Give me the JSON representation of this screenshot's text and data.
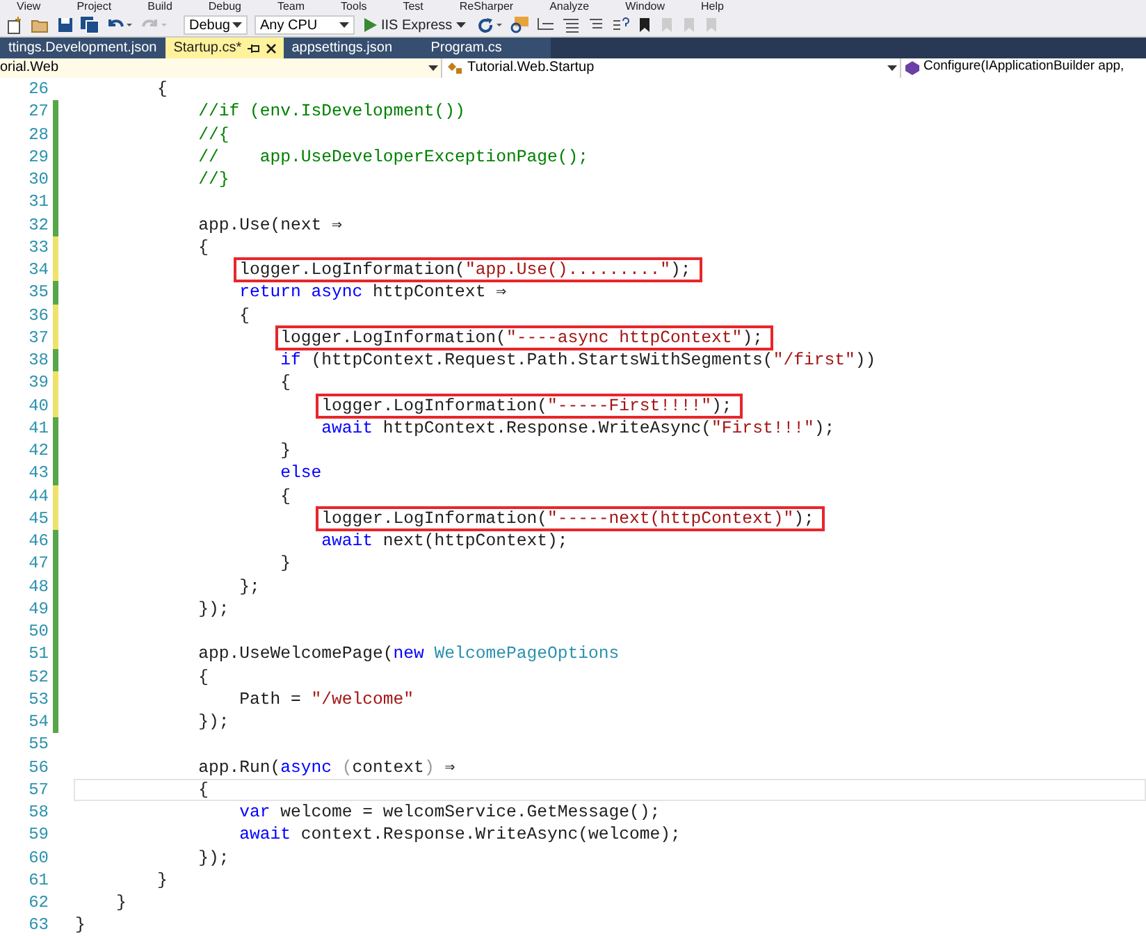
{
  "menu_bar": [
    "View",
    "Project",
    "Build",
    "Debug",
    "Team",
    "Tools",
    "Test",
    "ReSharper",
    "Analyze",
    "Window",
    "Help"
  ],
  "toolbar": {
    "configuration": "Debug",
    "platform": "Any CPU",
    "run_target": "IIS Express"
  },
  "tabs": [
    {
      "label": "ttings.Development.json",
      "selected": false
    },
    {
      "label": "Startup.cs*",
      "selected": true
    },
    {
      "label": "appsettings.json",
      "selected": false
    },
    {
      "label": "Program.cs",
      "selected": false
    }
  ],
  "navigation_bar": {
    "project": "orial.Web",
    "type": "Tutorial.Web.Startup",
    "member": "Configure(IApplicationBuilder app,"
  },
  "code_lines": [
    {
      "number": "26",
      "boxed": false,
      "current": false,
      "segments": [
        {
          "text": "        {",
          "kind": "plain"
        }
      ]
    },
    {
      "number": "27",
      "color": "#57a64a",
      "boxed": false,
      "current": false,
      "segments": [
        {
          "text": "            //if (env.IsDevelopment())",
          "kind": "comment"
        }
      ]
    },
    {
      "number": "28",
      "color": "#57a64a",
      "boxed": false,
      "current": false,
      "segments": [
        {
          "text": "            //{",
          "kind": "comment"
        }
      ]
    },
    {
      "number": "29",
      "color": "#57a64a",
      "boxed": false,
      "current": false,
      "segments": [
        {
          "text": "            //    app.UseDeveloperExceptionPage();",
          "kind": "comment"
        }
      ]
    },
    {
      "number": "30",
      "color": "#57a64a",
      "boxed": false,
      "current": false,
      "segments": [
        {
          "text": "            //}",
          "kind": "comment"
        }
      ]
    },
    {
      "number": "31",
      "color": "#57a64a",
      "current": false
    },
    {
      "number": "32",
      "color": "#57a64a",
      "boxed": false,
      "current": false,
      "segments": [
        {
          "text": "            app.Use(next ⇒",
          "kind": "plain"
        }
      ]
    },
    {
      "number": "33",
      "color": "#efe26b",
      "boxed": false,
      "current": false,
      "segments": [
        {
          "text": "            {",
          "kind": "plain"
        }
      ]
    },
    {
      "number": "34",
      "color": "#efe26b",
      "boxed": true,
      "current": false,
      "segments": [
        {
          "text": "                logger.LogInformation(",
          "kind": "plain"
        },
        {
          "text": "\"app.Use().........\"",
          "kind": "string"
        },
        {
          "text": ");",
          "kind": "plain"
        }
      ]
    },
    {
      "number": "35",
      "color": "#57a64a",
      "boxed": false,
      "current": false,
      "segments": [
        {
          "text": "                return async",
          "kind": "keyword"
        },
        {
          "text": " httpContext ⇒",
          "kind": "plain"
        }
      ]
    },
    {
      "number": "36",
      "color": "#efe26b",
      "boxed": false,
      "current": false,
      "segments": [
        {
          "text": "                {",
          "kind": "plain"
        }
      ]
    },
    {
      "number": "37",
      "color": "#efe26b",
      "boxed": true,
      "current": false,
      "segments": [
        {
          "text": "                    logger.LogInformation(",
          "kind": "plain"
        },
        {
          "text": "\"----async httpContext\"",
          "kind": "string"
        },
        {
          "text": ");",
          "kind": "plain"
        }
      ]
    },
    {
      "number": "38",
      "color": "#57a64a",
      "boxed": false,
      "current": false,
      "segments": [
        {
          "text": "                    if",
          "kind": "keyword"
        },
        {
          "text": " (httpContext.Request.Path.StartsWithSegments(",
          "kind": "plain"
        },
        {
          "text": "\"/first\"",
          "kind": "string"
        },
        {
          "text": "))",
          "kind": "plain"
        }
      ]
    },
    {
      "number": "39",
      "color": "#efe26b",
      "boxed": false,
      "current": false,
      "segments": [
        {
          "text": "                    {",
          "kind": "plain"
        }
      ]
    },
    {
      "number": "40",
      "color": "#efe26b",
      "boxed": true,
      "current": false,
      "segments": [
        {
          "text": "                        logger.LogInformation(",
          "kind": "plain"
        },
        {
          "text": "\"-----First!!!!\"",
          "kind": "string"
        },
        {
          "text": ");",
          "kind": "plain"
        }
      ]
    },
    {
      "number": "41",
      "color": "#57a64a",
      "boxed": false,
      "current": false,
      "segments": [
        {
          "text": "                        await",
          "kind": "keyword"
        },
        {
          "text": " httpContext.Response.WriteAsync(",
          "kind": "plain"
        },
        {
          "text": "\"First!!!\"",
          "kind": "string"
        },
        {
          "text": ");",
          "kind": "plain"
        }
      ]
    },
    {
      "number": "42",
      "color": "#57a64a",
      "boxed": false,
      "current": false,
      "segments": [
        {
          "text": "                    }",
          "kind": "plain"
        }
      ]
    },
    {
      "number": "43",
      "color": "#57a64a",
      "boxed": false,
      "current": false,
      "segments": [
        {
          "text": "                    else",
          "kind": "keyword"
        }
      ]
    },
    {
      "number": "44",
      "color": "#efe26b",
      "boxed": false,
      "current": false,
      "segments": [
        {
          "text": "                    {",
          "kind": "plain"
        }
      ]
    },
    {
      "number": "45",
      "color": "#efe26b",
      "boxed": true,
      "current": false,
      "segments": [
        {
          "text": "                        logger.LogInformation(",
          "kind": "plain"
        },
        {
          "text": "\"-----next(httpContext)\"",
          "kind": "string"
        },
        {
          "text": ");",
          "kind": "plain"
        }
      ]
    },
    {
      "number": "46",
      "color": "#57a64a",
      "boxed": false,
      "current": false,
      "segments": [
        {
          "text": "                        await",
          "kind": "keyword"
        },
        {
          "text": " next(httpContext);",
          "kind": "plain"
        }
      ]
    },
    {
      "number": "47",
      "color": "#57a64a",
      "boxed": false,
      "current": false,
      "segments": [
        {
          "text": "                    }",
          "kind": "plain"
        }
      ]
    },
    {
      "number": "48",
      "color": "#57a64a",
      "boxed": false,
      "current": false,
      "segments": [
        {
          "text": "                };",
          "kind": "plain"
        }
      ]
    },
    {
      "number": "49",
      "color": "#57a64a",
      "boxed": false,
      "current": false,
      "segments": [
        {
          "text": "            });",
          "kind": "plain"
        }
      ]
    },
    {
      "number": "50",
      "color": "#57a64a",
      "current": false
    },
    {
      "number": "51",
      "color": "#57a64a",
      "boxed": false,
      "current": false,
      "segments": [
        {
          "text": "            app.UseWelcomePage(",
          "kind": "plain"
        },
        {
          "text": "new",
          "kind": "keyword"
        },
        {
          "text": " WelcomePageOptions",
          "kind": "type"
        }
      ]
    },
    {
      "number": "52",
      "color": "#57a64a",
      "boxed": false,
      "current": false,
      "segments": [
        {
          "text": "            {",
          "kind": "plain"
        }
      ]
    },
    {
      "number": "53",
      "color": "#57a64a",
      "boxed": false,
      "current": false,
      "segments": [
        {
          "text": "                Path = ",
          "kind": "plain"
        },
        {
          "text": "\"/welcome\"",
          "kind": "string"
        }
      ]
    },
    {
      "number": "54",
      "color": "#57a64a",
      "boxed": false,
      "current": false,
      "segments": [
        {
          "text": "            });",
          "kind": "plain"
        }
      ]
    },
    {
      "number": "55",
      "current": false
    },
    {
      "number": "56",
      "boxed": false,
      "current": false,
      "segments": [
        {
          "text": "            app.Run(",
          "kind": "plain"
        },
        {
          "text": "async",
          "kind": "keyword"
        },
        {
          "text": " (",
          "kind": "dim"
        },
        {
          "text": "context",
          "kind": "plain"
        },
        {
          "text": ")",
          "kind": "dim"
        },
        {
          "text": " ⇒",
          "kind": "plain"
        }
      ]
    },
    {
      "number": "57",
      "boxed": false,
      "current": true,
      "segments": [
        {
          "text": "            {",
          "kind": "plain"
        }
      ]
    },
    {
      "number": "58",
      "boxed": false,
      "current": false,
      "segments": [
        {
          "text": "                var",
          "kind": "keyword"
        },
        {
          "text": " welcome = welcomService.GetMessage();",
          "kind": "plain"
        }
      ]
    },
    {
      "number": "59",
      "boxed": false,
      "current": false,
      "segments": [
        {
          "text": "                await",
          "kind": "keyword"
        },
        {
          "text": " context.Response.WriteAsync(welcome);",
          "kind": "plain"
        }
      ]
    },
    {
      "number": "60",
      "boxed": false,
      "current": false,
      "segments": [
        {
          "text": "            });",
          "kind": "plain"
        }
      ]
    },
    {
      "number": "61",
      "boxed": false,
      "current": false,
      "segments": [
        {
          "text": "        }",
          "kind": "plain"
        }
      ]
    },
    {
      "number": "62",
      "boxed": false,
      "current": false,
      "segments": [
        {
          "text": "    }",
          "kind": "plain"
        }
      ]
    },
    {
      "number": "63",
      "boxed": false,
      "current": false,
      "segments": [
        {
          "text": "}",
          "kind": "plain"
        }
      ]
    }
  ]
}
